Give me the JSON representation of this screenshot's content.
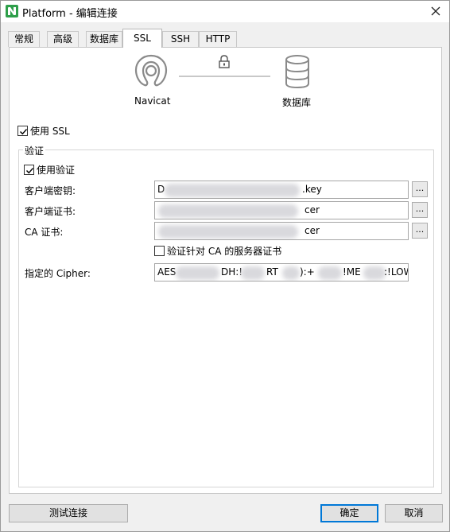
{
  "window": {
    "title": "Platform - 编辑连接"
  },
  "tabs": [
    {
      "label": "常规"
    },
    {
      "label": "高级"
    },
    {
      "label": "数据库"
    },
    {
      "label": "SSL"
    },
    {
      "label": "SSH"
    },
    {
      "label": "HTTP"
    }
  ],
  "active_tab": "SSL",
  "diagram": {
    "left_label": "Navicat",
    "right_label": "数据库"
  },
  "use_ssl": {
    "label": "使用 SSL",
    "checked": true
  },
  "auth_group": {
    "title": "验证",
    "use_auth": {
      "label": "使用验证",
      "checked": true
    },
    "client_key": {
      "label": "客户端密钥:",
      "value_start": "D",
      "value_end": ".key"
    },
    "client_cert": {
      "label": "客户端证书:",
      "value_end": "cer"
    },
    "ca_cert": {
      "label": "CA 证书:",
      "value_end": "cer"
    },
    "verify_ca": {
      "label": "验证针对 CA 的服务器证书",
      "checked": false
    },
    "cipher": {
      "label": "指定的 Cipher:",
      "parts": [
        "AES",
        "DH:!",
        "RT",
        "):+",
        "!ME",
        ":!LOW"
      ]
    }
  },
  "browse_button_label": "...",
  "footer": {
    "test_button": "测试连接",
    "ok_button": "确定",
    "cancel_button": "取消"
  }
}
